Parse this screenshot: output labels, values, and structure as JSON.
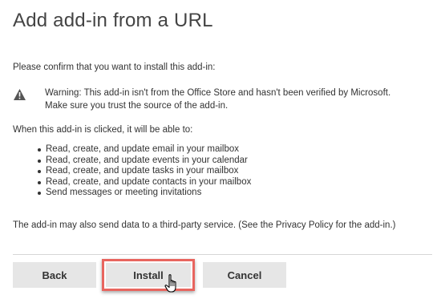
{
  "dialog": {
    "title": "Add add-in from a URL",
    "confirm_text": "Please confirm that you want to install this add-in:",
    "warning": {
      "icon": "warning-triangle-icon",
      "line1": "Warning: This add-in isn't from the Office Store and hasn't been verified by Microsoft.",
      "line2": "Make sure you trust the source of the add-in."
    },
    "when_clicked_text": "When this add-in is clicked, it will be able to:",
    "permissions": [
      "Read, create, and update email in your mailbox",
      "Read, create, and update events in your calendar",
      "Read, create, and update tasks in your mailbox",
      "Read, create, and update contacts in your mailbox",
      "Send messages or meeting invitations"
    ],
    "third_party_text": "The add-in may also send data to a third-party service. (See the Privacy Policy for the add-in.)",
    "buttons": {
      "back": "Back",
      "install": "Install",
      "cancel": "Cancel"
    },
    "highlight_color": "#e8655f",
    "cursor_icon": "hand-pointer-icon"
  }
}
